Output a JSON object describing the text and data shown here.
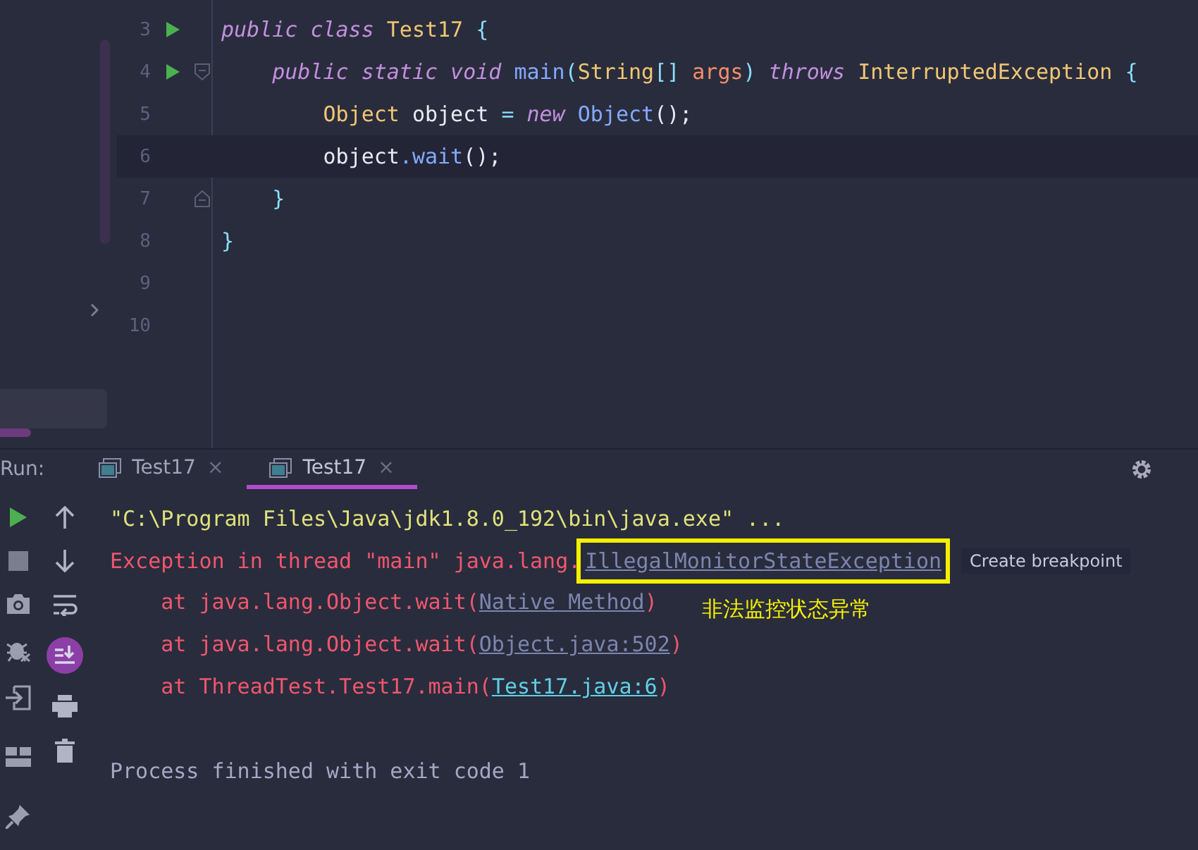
{
  "editor": {
    "lines": [
      {
        "number": "3",
        "run_marker": true,
        "fold_start": false,
        "fold_end": false,
        "current": false,
        "tokens": [
          {
            "text": "public class ",
            "kind": "keyword"
          },
          {
            "text": "Test17",
            "kind": "type"
          },
          {
            "text": " {",
            "kind": "brace"
          }
        ]
      },
      {
        "number": "4",
        "run_marker": true,
        "fold_start": true,
        "fold_end": false,
        "current": false,
        "tokens": [
          {
            "text": "    public static void ",
            "kind": "keyword"
          },
          {
            "text": "main",
            "kind": "method"
          },
          {
            "text": "(",
            "kind": "brace"
          },
          {
            "text": "String",
            "kind": "type"
          },
          {
            "text": "[] ",
            "kind": "brace"
          },
          {
            "text": "args",
            "kind": "param"
          },
          {
            "text": ") ",
            "kind": "brace"
          },
          {
            "text": "throws ",
            "kind": "keyword"
          },
          {
            "text": "InterruptedException",
            "kind": "type"
          },
          {
            "text": " {",
            "kind": "brace"
          }
        ]
      },
      {
        "number": "5",
        "run_marker": false,
        "fold_start": false,
        "fold_end": false,
        "current": false,
        "tokens": [
          {
            "text": "        Object",
            "kind": "type"
          },
          {
            "text": " object ",
            "kind": "plain"
          },
          {
            "text": "=",
            "kind": "brace"
          },
          {
            "text": " new ",
            "kind": "keyword"
          },
          {
            "text": "Object",
            "kind": "method"
          },
          {
            "text": "();",
            "kind": "plain"
          }
        ]
      },
      {
        "number": "6",
        "run_marker": false,
        "fold_start": false,
        "fold_end": false,
        "current": true,
        "tokens": [
          {
            "text": "        object",
            "kind": "plain"
          },
          {
            "text": ".wait",
            "kind": "method"
          },
          {
            "text": "();",
            "kind": "plain"
          }
        ]
      },
      {
        "number": "7",
        "run_marker": false,
        "fold_start": false,
        "fold_end": true,
        "current": false,
        "tokens": [
          {
            "text": "    }",
            "kind": "brace"
          }
        ]
      },
      {
        "number": "8",
        "run_marker": false,
        "fold_start": false,
        "fold_end": false,
        "current": false,
        "tokens": [
          {
            "text": "}",
            "kind": "brace"
          }
        ]
      },
      {
        "number": "9",
        "run_marker": false,
        "fold_start": false,
        "fold_end": false,
        "current": false
      },
      {
        "number": "10",
        "run_marker": false,
        "fold_start": false,
        "fold_end": false,
        "current": false
      }
    ]
  },
  "run_panel": {
    "label": "Run:",
    "tabs": [
      {
        "label": "Test17",
        "close": "×",
        "selected": false
      },
      {
        "label": "Test17",
        "close": "×",
        "selected": true
      }
    ],
    "scroll_to_end": {
      "on": true
    }
  },
  "console": {
    "lines": [
      {
        "segments": [
          {
            "text": "\"C:\\Program Files\\Java\\jdk1.8.0_192\\bin\\java.exe\" ...",
            "kind": "command"
          }
        ]
      },
      {
        "segments": [
          {
            "text": "Exception in thread \"main\" java.lang.",
            "kind": "error"
          },
          {
            "text": "IllegalMonitorStateException",
            "kind": "boxed-link"
          }
        ],
        "hint": "Create breakpoint"
      },
      {
        "segments": [
          {
            "text": "    at java.lang.Object.wait(",
            "kind": "error"
          },
          {
            "text": "Native Method",
            "kind": "muted-link"
          },
          {
            "text": ")",
            "kind": "error"
          }
        ]
      },
      {
        "segments": [
          {
            "text": "    at java.lang.Object.wait(",
            "kind": "error"
          },
          {
            "text": "Object.java:502",
            "kind": "muted-link"
          },
          {
            "text": ")",
            "kind": "error"
          }
        ]
      },
      {
        "segments": [
          {
            "text": "    at ThreadTest.Test17.main(",
            "kind": "error"
          },
          {
            "text": "Test17.java:6",
            "kind": "link"
          },
          {
            "text": ")",
            "kind": "error"
          }
        ]
      },
      {
        "kind": "blank"
      },
      {
        "segments": [
          {
            "text": "Process finished with exit code 1",
            "kind": "info"
          }
        ]
      }
    ],
    "annotation": "非法监控状态异常"
  }
}
